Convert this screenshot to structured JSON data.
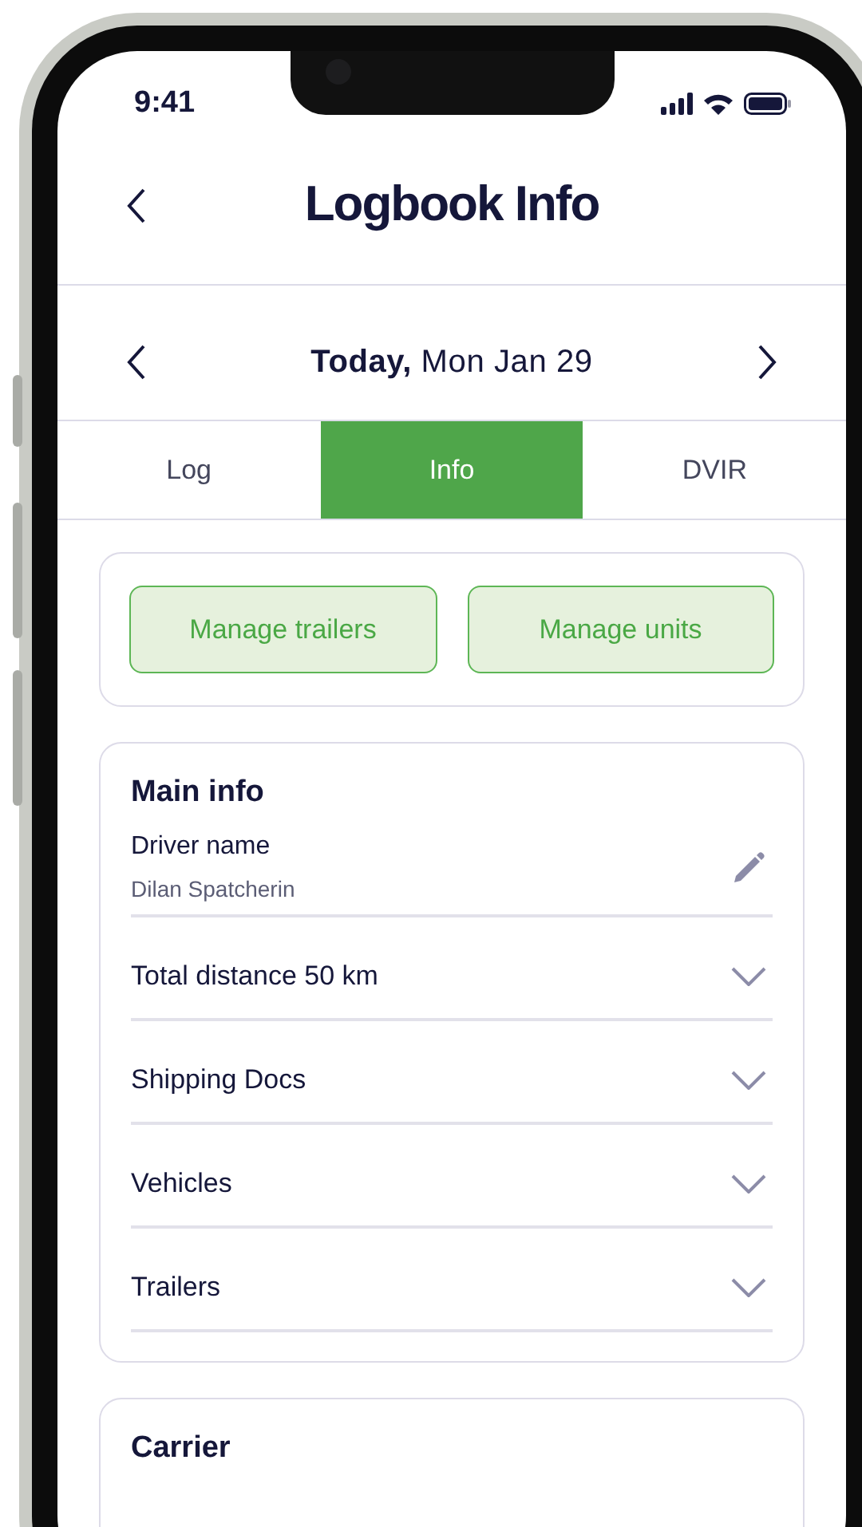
{
  "status_bar": {
    "time": "9:41"
  },
  "header": {
    "title": "Logbook Info"
  },
  "date_nav": {
    "label": "**Today,** Mon Jan 29"
  },
  "tabs": [
    {
      "label": "Log",
      "selected": false
    },
    {
      "label": "Info",
      "selected": true
    },
    {
      "label": "DVIR",
      "selected": false
    }
  ],
  "actions": [
    "Manage trailers",
    "Manage units"
  ],
  "main_info": {
    "title": "Main info",
    "driver": {
      "label": "Driver name",
      "value": "Dilan Spatcherin"
    },
    "sections": [
      {
        "label": "Total distance 50 km",
        "expanded": false
      },
      {
        "label": "Shipping Docs",
        "expanded": false
      },
      {
        "label": "Vehicles",
        "expanded": false
      },
      {
        "label": "Trailers",
        "expanded": false
      }
    ]
  },
  "carrier": {
    "title": "Carrier"
  }
}
